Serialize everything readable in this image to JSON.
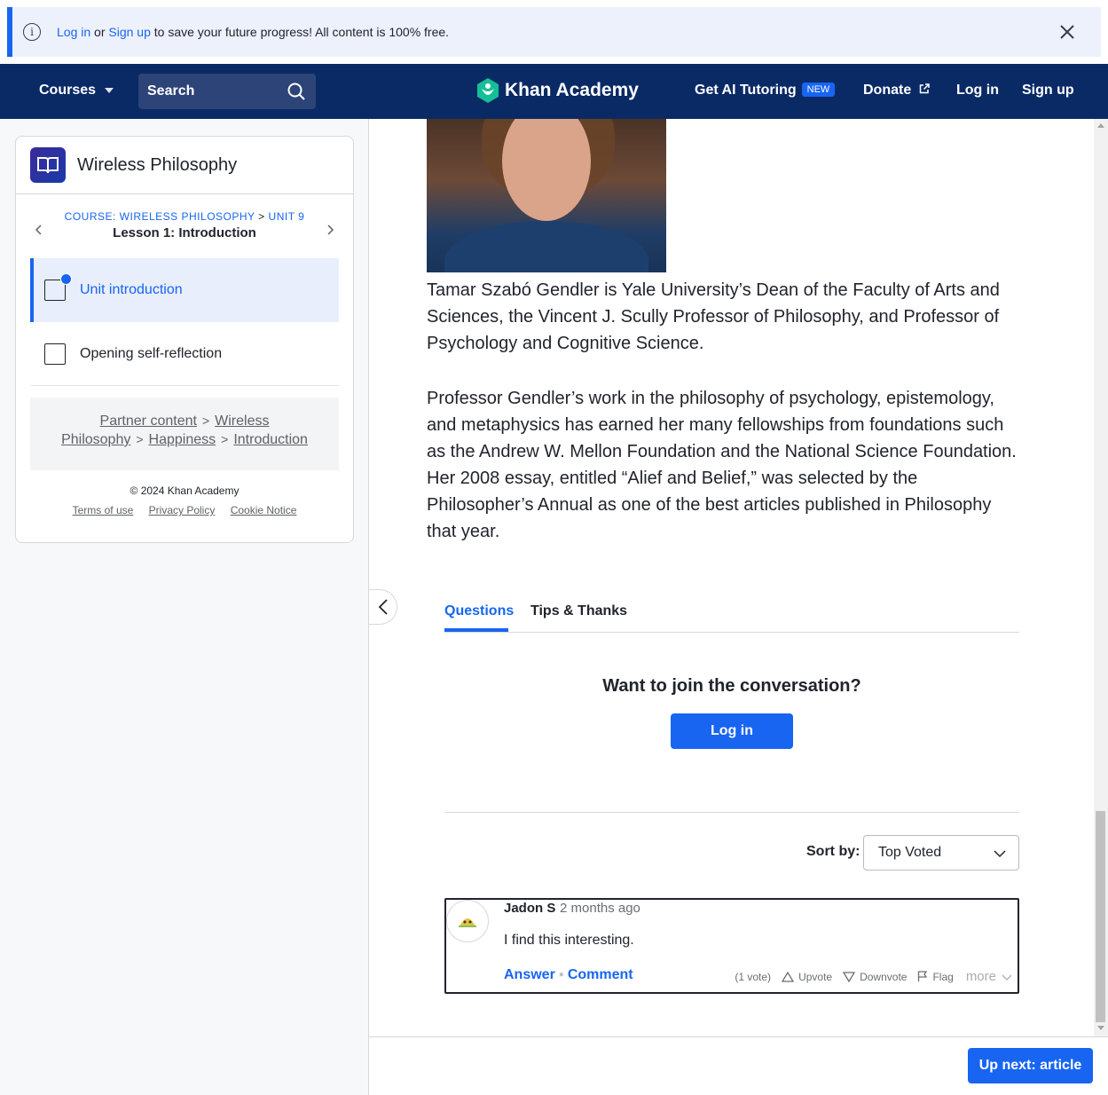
{
  "banner": {
    "login_link": "Log in",
    "or_text": "or",
    "signup_link": "Sign up",
    "message": "to save your future progress! All content is 100% free."
  },
  "nav": {
    "courses": "Courses",
    "search_placeholder": "Search",
    "logo_text": "Khan Academy",
    "ai_tutoring": "Get AI Tutoring",
    "new_badge": "NEW",
    "donate": "Donate",
    "login": "Log in",
    "signup": "Sign up"
  },
  "sidebar": {
    "course_title": "Wireless Philosophy",
    "breadcrumb_course": "COURSE: WIRELESS PHILOSOPHY",
    "breadcrumb_sep": ">",
    "breadcrumb_unit": "UNIT 9",
    "lesson_title": "Lesson 1: Introduction",
    "items": [
      {
        "label": "Unit introduction"
      },
      {
        "label": "Opening self-reflection"
      }
    ],
    "partner": {
      "partner_content": "Partner content",
      "wireless": "Wireless",
      "philosophy": "Philosophy",
      "happiness": "Happiness",
      "introduction": "Introduction",
      "gt": ">"
    },
    "footer": {
      "copyright": "© 2024 Khan Academy",
      "terms": "Terms of use",
      "privacy": "Privacy Policy",
      "cookie": "Cookie Notice"
    }
  },
  "article": {
    "paragraph1": "Tamar Szabó Gendler is Yale University’s Dean of the Faculty of Arts and Sciences, the Vincent J. Scully Professor of Philosophy, and Professor of Psychology and Cognitive Science.",
    "paragraph2": "Professor Gendler’s work in the philosophy of psychology, epistemology, and metaphysics has earned her many fellowships from foundations such as the Andrew W. Mellon Foundation and the National Science Foundation. Her 2008 essay, entitled “Alief and Belief,” was selected by the Philosopher’s Annual as one of the best articles published in Philosophy that year."
  },
  "discussion": {
    "tabs": [
      "Questions",
      "Tips & Thanks"
    ],
    "join_prompt": "Want to join the conversation?",
    "login_button": "Log in",
    "sort_label": "Sort by:",
    "sort_value": "Top Voted",
    "comment": {
      "author": "Jadon S",
      "time": "2 months ago",
      "body": "I find this interesting.",
      "answer": "Answer",
      "comment_link": "Comment",
      "votes": "(1 vote)",
      "upvote": "Upvote",
      "downvote": "Downvote",
      "flag": "Flag",
      "more": "more"
    }
  },
  "bottom": {
    "up_next": "Up next: article"
  },
  "colors": {
    "brand_blue": "#1865f2",
    "nav_bg": "#0a2a66",
    "logo_green": "#14bf96"
  }
}
